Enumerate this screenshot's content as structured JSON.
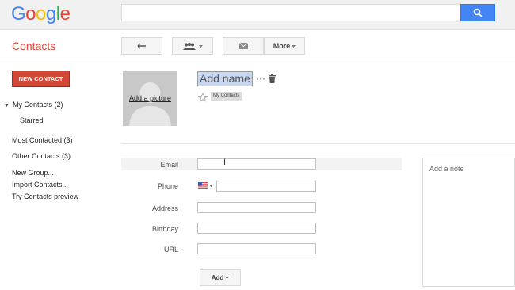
{
  "header": {
    "logo": [
      "G",
      "o",
      "o",
      "g",
      "l",
      "e"
    ],
    "search": {
      "value": "",
      "placeholder": ""
    }
  },
  "app": {
    "title": "Contacts"
  },
  "toolbar": {
    "more_label": "More"
  },
  "sidebar": {
    "new_contact": "NEW CONTACT",
    "my_contacts": "My Contacts (2)",
    "starred": "Starred",
    "most_contacted": "Most Contacted (3)",
    "other_contacts": "Other Contacts (3)",
    "new_group": "New Group...",
    "import_contacts": "Import Contacts...",
    "try_preview": "Try Contacts preview"
  },
  "profile": {
    "add_picture": "Add a picture",
    "name_placeholder": "Add name",
    "group_chip": "My Contacts"
  },
  "form": {
    "email_label": "Email",
    "phone_label": "Phone",
    "address_label": "Address",
    "birthday_label": "Birthday",
    "url_label": "URL",
    "note_placeholder": "Add a note",
    "add_label": "Add"
  },
  "colors": {
    "accent_red": "#dd4b39",
    "button_red": "#d14836",
    "search_blue": "#4285f4",
    "name_highlight": "#c7d7f2"
  }
}
